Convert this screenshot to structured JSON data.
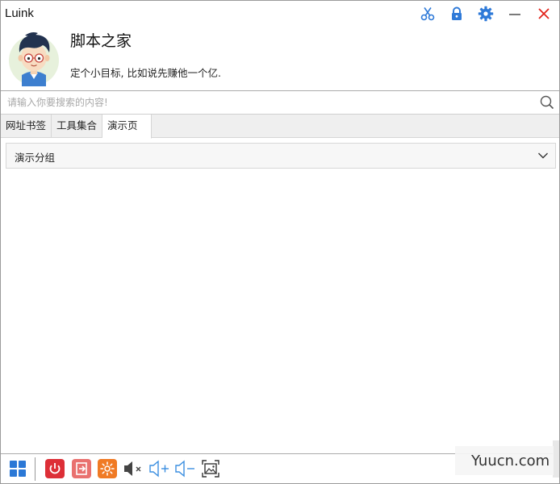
{
  "window": {
    "title": "Luink"
  },
  "titlebar": {
    "icons": [
      "scissors-icon",
      "lock-icon",
      "gear-icon",
      "minimize-icon",
      "close-icon"
    ],
    "colors": {
      "icon_blue": "#2f7ad8",
      "close_red": "#e2231a"
    }
  },
  "profile": {
    "name": "脚本之家",
    "motto": "定个小目标, 比如说先赚他一个亿."
  },
  "search": {
    "placeholder": "请输入你要搜索的内容!",
    "value": ""
  },
  "tabs": [
    {
      "label": "网址书签",
      "active": false
    },
    {
      "label": "工具集合",
      "active": false
    },
    {
      "label": "演示页面",
      "active": true
    }
  ],
  "groups": [
    {
      "label": "演示分组",
      "expanded": false
    }
  ],
  "bottombar": {
    "buttons": [
      "windows-start-icon",
      "power-icon",
      "logout-icon",
      "sun-icon",
      "mute-icon",
      "volume-up-icon",
      "volume-down-icon",
      "screenshot-icon"
    ],
    "colors": {
      "start": "#2b78d6",
      "power": "#dd2f37",
      "logout": "#e9716f",
      "sun": "#f07a24",
      "volume": "#3b8fe0"
    }
  },
  "watermark": {
    "text": "Yuucn.com"
  }
}
